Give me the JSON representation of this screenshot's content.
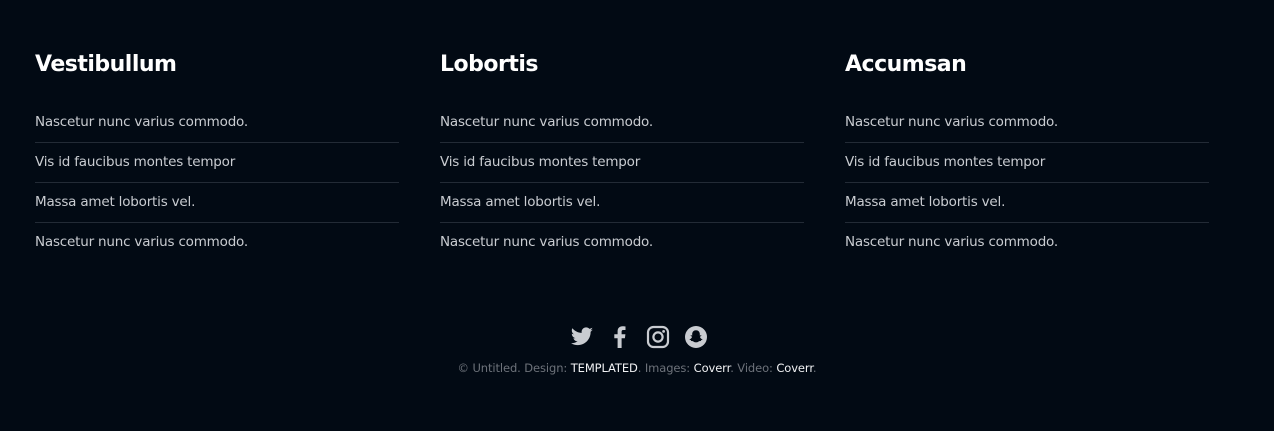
{
  "columns": [
    {
      "heading": "Vestibullum",
      "items": [
        "Nascetur nunc varius commodo.",
        "Vis id faucibus montes tempor",
        "Massa amet lobortis vel.",
        "Nascetur nunc varius commodo."
      ]
    },
    {
      "heading": "Lobortis",
      "items": [
        "Nascetur nunc varius commodo.",
        "Vis id faucibus montes tempor",
        "Massa amet lobortis vel.",
        "Nascetur nunc varius commodo."
      ]
    },
    {
      "heading": "Accumsan",
      "items": [
        "Nascetur nunc varius commodo.",
        "Vis id faucibus montes tempor",
        "Massa amet lobortis vel.",
        "Nascetur nunc varius commodo."
      ]
    }
  ],
  "social": {
    "icons": [
      "twitter-icon",
      "facebook-icon",
      "instagram-icon",
      "snapchat-icon"
    ]
  },
  "copyright": {
    "prefix": "© Untitled. Design: ",
    "design_link": "TEMPLATED",
    "images_text": ". Images: ",
    "images_link": "Coverr",
    "video_text": ". Video: ",
    "video_link": "Coverr",
    "suffix": "."
  },
  "colors": {
    "background": "#020a14",
    "heading": "#ffffff",
    "text": "#c9ccd1",
    "muted": "#6d727a",
    "divider": "#232b36"
  }
}
